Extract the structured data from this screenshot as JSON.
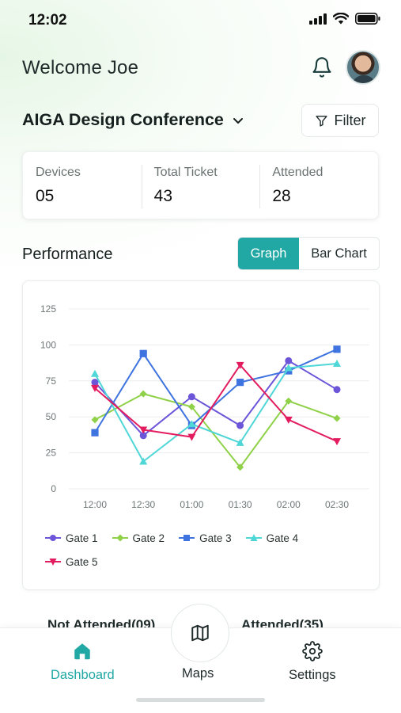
{
  "status": {
    "time": "12:02"
  },
  "header": {
    "welcome": "Welcome Joe",
    "event_title": "AIGA Design Conference",
    "filter_label": "Filter"
  },
  "stats": [
    {
      "label": "Devices",
      "value": "05"
    },
    {
      "label": "Total Ticket",
      "value": "43"
    },
    {
      "label": "Attended",
      "value": "28"
    }
  ],
  "performance": {
    "title": "Performance",
    "toggle": {
      "graph": "Graph",
      "bar_chart": "Bar Chart",
      "active": "graph"
    }
  },
  "chart_data": {
    "type": "line",
    "x": [
      "12:00",
      "12:30",
      "01:00",
      "01:30",
      "02:00",
      "02:30"
    ],
    "yticks": [
      0,
      25,
      50,
      75,
      100,
      125
    ],
    "ylim": [
      0,
      125
    ],
    "grid": true,
    "legend_position": "bottom-left",
    "series": [
      {
        "name": "Gate 1",
        "color": "#6c55d9",
        "marker": "circle",
        "values": [
          74,
          37,
          64,
          44,
          89,
          69
        ]
      },
      {
        "name": "Gate 2",
        "color": "#8fd148",
        "marker": "diamond",
        "values": [
          48,
          66,
          57,
          15,
          61,
          49
        ]
      },
      {
        "name": "Gate 3",
        "color": "#3f74e0",
        "marker": "square",
        "values": [
          39,
          94,
          44,
          74,
          82,
          97
        ]
      },
      {
        "name": "Gate 4",
        "color": "#4fd6d6",
        "marker": "triangle",
        "values": [
          80,
          19,
          45,
          32,
          84,
          87
        ]
      },
      {
        "name": "Gate 5",
        "color": "#e21c5f",
        "marker": "triangle-down",
        "values": [
          70,
          41,
          36,
          86,
          48,
          33
        ]
      }
    ]
  },
  "tabs_peek": {
    "not_attended": "Not Attended(09)",
    "attended": "Attended(35)"
  },
  "nav": {
    "dashboard": "Dashboard",
    "maps": "Maps",
    "settings": "Settings",
    "active": "dashboard"
  },
  "colors": {
    "accent": "#22a8a4"
  }
}
